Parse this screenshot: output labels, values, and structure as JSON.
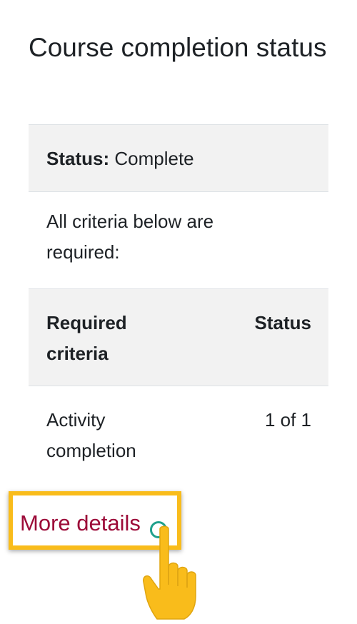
{
  "block": {
    "title": "Course completion status"
  },
  "status_row": {
    "label": "Status:",
    "value": "Complete"
  },
  "intro": {
    "text": "All criteria below are required:"
  },
  "criteria_table": {
    "headers": [
      "Required criteria",
      "Status"
    ],
    "rows": [
      {
        "criteria": "Activity completion",
        "status": "1 of 1"
      }
    ]
  },
  "more_details": {
    "label": "More details"
  },
  "colors": {
    "link": "#9c0a38",
    "highlight_border": "#f9bc1b",
    "pointer_hand": "#f9bc1b",
    "click_ring": "#1fa08c"
  },
  "icons": {
    "pointer": "pointing-hand-icon",
    "click": "click-indicator-icon"
  }
}
